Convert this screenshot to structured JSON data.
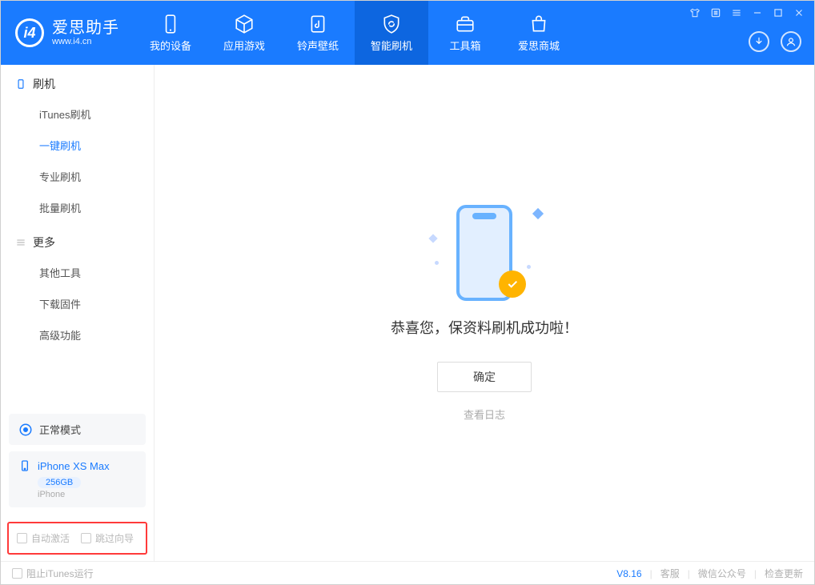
{
  "app": {
    "title": "爱思助手",
    "subtitle": "www.i4.cn"
  },
  "topTabs": [
    {
      "label": "我的设备"
    },
    {
      "label": "应用游戏"
    },
    {
      "label": "铃声壁纸"
    },
    {
      "label": "智能刷机"
    },
    {
      "label": "工具箱"
    },
    {
      "label": "爱思商城"
    }
  ],
  "sidebar": {
    "section1": {
      "header": "刷机",
      "items": [
        "iTunes刷机",
        "一键刷机",
        "专业刷机",
        "批量刷机"
      ]
    },
    "section2": {
      "header": "更多",
      "items": [
        "其他工具",
        "下载固件",
        "高级功能"
      ]
    }
  },
  "mode": "正常模式",
  "device": {
    "name": "iPhone XS Max",
    "capacity": "256GB",
    "type": "iPhone"
  },
  "options": {
    "autoActivate": "自动激活",
    "skipGuide": "跳过向导"
  },
  "main": {
    "successMsg": "恭喜您，保资料刷机成功啦！",
    "okBtn": "确定",
    "logLink": "查看日志"
  },
  "footer": {
    "blockItunes": "阻止iTunes运行",
    "version": "V8.16",
    "links": [
      "客服",
      "微信公众号",
      "检查更新"
    ]
  }
}
